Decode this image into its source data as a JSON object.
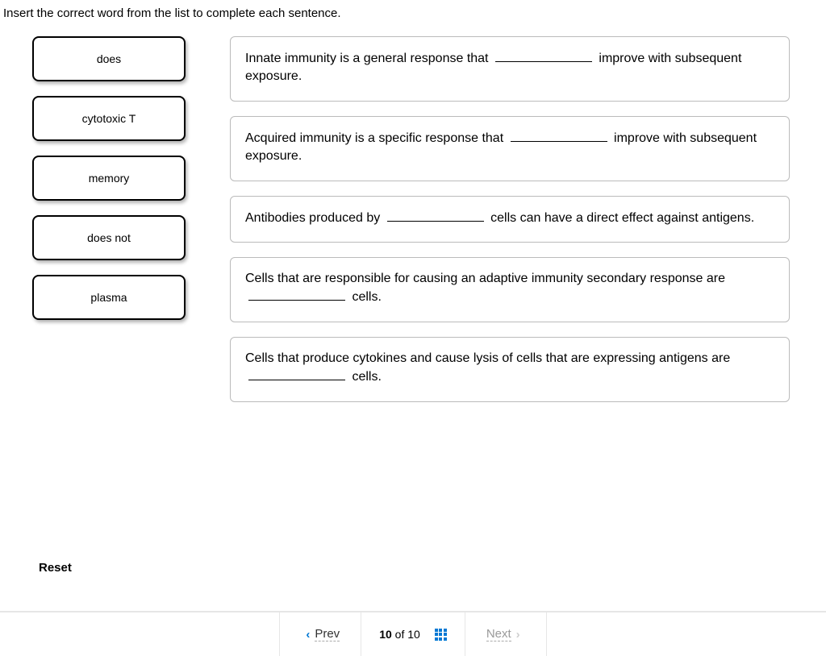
{
  "instruction": "Insert the correct word from the list to complete each sentence.",
  "word_bank": [
    {
      "label": "does"
    },
    {
      "label": "cytotoxic T"
    },
    {
      "label": "memory"
    },
    {
      "label": "does not"
    },
    {
      "label": "plasma"
    }
  ],
  "sentences": [
    {
      "pre": "Innate immunity is a general response that ",
      "post": " improve with subsequent exposure."
    },
    {
      "pre": "Acquired immunity is a specific response that ",
      "post": " improve with subsequent exposure."
    },
    {
      "pre": "Antibodies produced by ",
      "post": " cells can have a direct effect against antigens."
    },
    {
      "pre": "Cells that are responsible for causing an adaptive immunity secondary response are ",
      "post": " cells."
    },
    {
      "pre": "Cells that produce cytokines and cause lysis of cells that are expressing antigens are ",
      "post": " cells."
    }
  ],
  "reset_label": "Reset",
  "nav": {
    "prev": "Prev",
    "next": "Next",
    "current": "10",
    "of": "of",
    "total": "10"
  }
}
